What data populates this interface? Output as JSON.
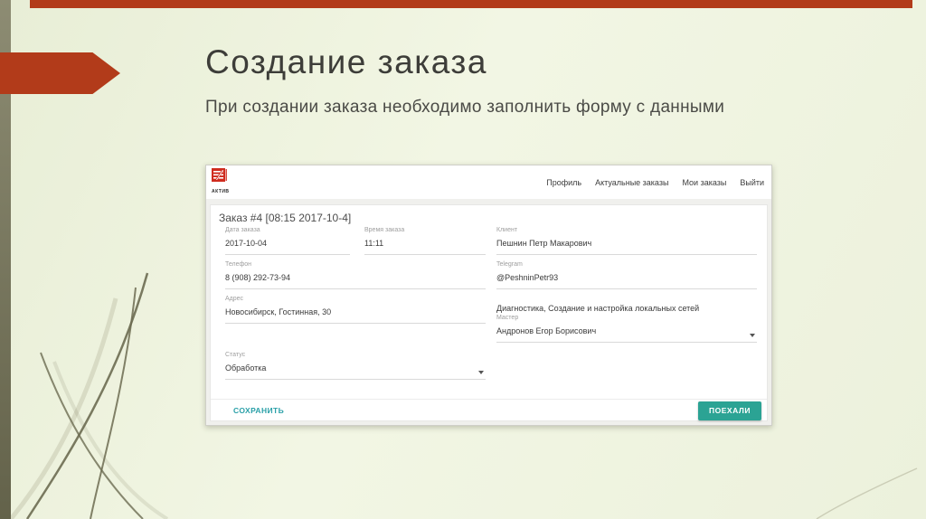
{
  "slide": {
    "title": "Создание заказа",
    "subtitle": "При создании заказа необходимо заполнить форму с данными"
  },
  "app": {
    "logo_text": "АКТИВ",
    "nav": [
      "Профиль",
      "Актуальные заказы",
      "Мои заказы",
      "Выйти"
    ],
    "order_header": "Заказ #4 [08:15 2017-10-4]",
    "fields": {
      "date": {
        "label": "Дата заказа",
        "value": "2017-10-04"
      },
      "time": {
        "label": "Время заказа",
        "value": "11:11"
      },
      "client": {
        "label": "Клиент",
        "value": "Пешнин Петр Макарович"
      },
      "phone": {
        "label": "Телефон",
        "value": "8 (908) 292-73-94"
      },
      "telegram": {
        "label": "Telegram",
        "value": "@PeshninPetr93"
      },
      "address": {
        "label": "Адрес",
        "value": "Новосибирск, Гостинная, 30"
      },
      "services": {
        "value": "Диагностика, Создание и настройка локальных сетей"
      },
      "master": {
        "label": "Мастер",
        "value": "Андронов Егор Борисович"
      },
      "status": {
        "label": "Статус",
        "value": "Обработка"
      }
    },
    "buttons": {
      "save": "СОХРАНИТЬ",
      "go": "ПОЕХАЛИ"
    }
  },
  "colors": {
    "accent_red": "#b23b1a",
    "olive": "#6c6b51",
    "teal_button": "#2ba394",
    "teal_link": "#2aa0a8"
  }
}
